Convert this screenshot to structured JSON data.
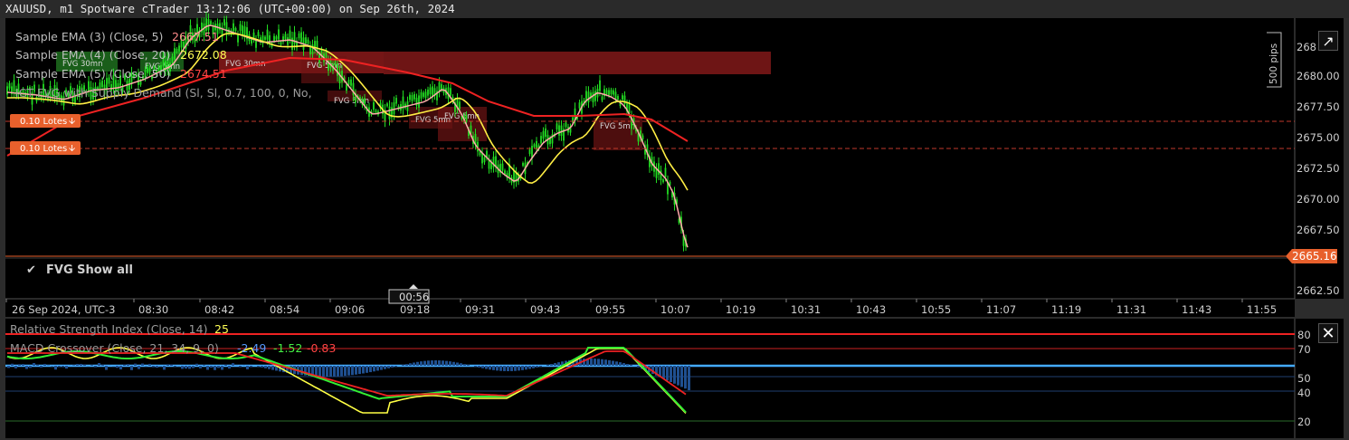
{
  "window": {
    "title": "XAUUSD, m1 Spotware cTrader 13:12:06 (UTC+00:00) on Sep 26th, 2024"
  },
  "main": {
    "indicators": [
      {
        "label": "Sample EMA (3) (Close, 5)",
        "value": "2667.51",
        "color": "#ff7f7f"
      },
      {
        "label": "Sample EMA (4) (Close, 20)",
        "value": "2672.08",
        "color": "#ffff55"
      },
      {
        "label": "Sample EMA (5) (Close, 50)",
        "value": "2674.51",
        "color": "#ff3333"
      },
      {
        "label": "ICT FVG with Supply Demand (Sl, Sl, 0.7, 100, 0, No,",
        "value": "",
        "color": "#aaaaaa"
      }
    ],
    "fvg_labels": [
      "FVG 30mn",
      "FVG 5mn",
      "FVG 30mn",
      "FVG 5mn",
      "FVG 5mn",
      "FVG 5mn",
      "FVG 5mn",
      "FVG 5mn"
    ],
    "order_lines": [
      {
        "label": "0.10 Lotes",
        "icon": "arrow-down-icon"
      },
      {
        "label": "0.10 Lotes",
        "icon": "arrow-down-icon"
      }
    ],
    "price_axis": [
      "2680.00",
      "2677.50",
      "2675.00",
      "2672.50",
      "2670.00",
      "2667.50",
      "2662.50"
    ],
    "price_axis_partial": "268",
    "current_price": "2665.16",
    "pips_label": "500 pips",
    "checkbox_label": "FVG Show all",
    "time_axis": [
      "26 Sep 2024, UTC-3",
      "08:30",
      "08:42",
      "08:54",
      "09:06",
      "09:18",
      "09:31",
      "09:43",
      "09:55",
      "10:07",
      "10:19",
      "10:31",
      "10:43",
      "10:55",
      "11:07",
      "11:19",
      "11:31",
      "11:43",
      "11:55"
    ],
    "time_cursor": "00:56"
  },
  "sub": {
    "indicators": [
      {
        "label": "Relative Strength Index (Close, 14)",
        "value": "25",
        "color": "#ffff55"
      },
      {
        "label": "MACD Crossover (Close, 21, 34, 9, 0)",
        "values": [
          "-2.49",
          "-1.52",
          "-0.83"
        ],
        "colors": [
          "#5599ff",
          "#44ee44",
          "#ff3333"
        ]
      }
    ],
    "axis": [
      "80",
      "70",
      "50",
      "40",
      "20"
    ]
  },
  "colors": {
    "bull": "#22dd22",
    "ema5": "#ffaaaa",
    "ema20": "#ffee44",
    "ema50": "#ee2222",
    "accent": "#e8602c",
    "macd_hist": "#1f4f8f",
    "zero_line": "#44aaff"
  }
}
